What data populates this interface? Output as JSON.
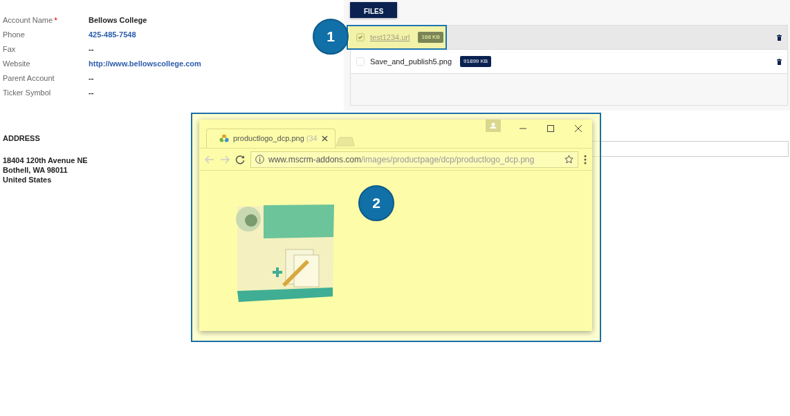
{
  "account_fields": [
    {
      "label": "Account Name",
      "required_mark": "*",
      "value": "Bellows College",
      "kind": "text"
    },
    {
      "label": "Phone",
      "value": "425-485-7548",
      "kind": "link"
    },
    {
      "label": "Fax",
      "value": "--",
      "kind": "text"
    },
    {
      "label": "Website",
      "value": "http://www.bellowscollege.com",
      "kind": "link"
    },
    {
      "label": "Parent Account",
      "value": "--",
      "kind": "text"
    },
    {
      "label": "Ticker Symbol",
      "value": "--",
      "kind": "text"
    }
  ],
  "address": {
    "heading": "ADDRESS",
    "lines": [
      "18404 120th Avenue NE",
      "Bothell, WA 98011",
      "United States"
    ]
  },
  "files": {
    "button": "FILES",
    "items": [
      {
        "name": "test1234.url",
        "size": "168 KB",
        "checked": true,
        "selected": true,
        "highlighted": true
      },
      {
        "name": "Save_and_publish5.png",
        "size": "91899 KB",
        "checked": false,
        "selected": false,
        "highlighted": false
      }
    ]
  },
  "callouts": [
    {
      "number": "1"
    },
    {
      "number": "2"
    }
  ],
  "browser": {
    "tab_title": "productlogo_dcp.png (34",
    "url_host": "www.mscrm-addons.com",
    "url_path": "/images/productpage/dcp/productlogo_dcp.png"
  }
}
